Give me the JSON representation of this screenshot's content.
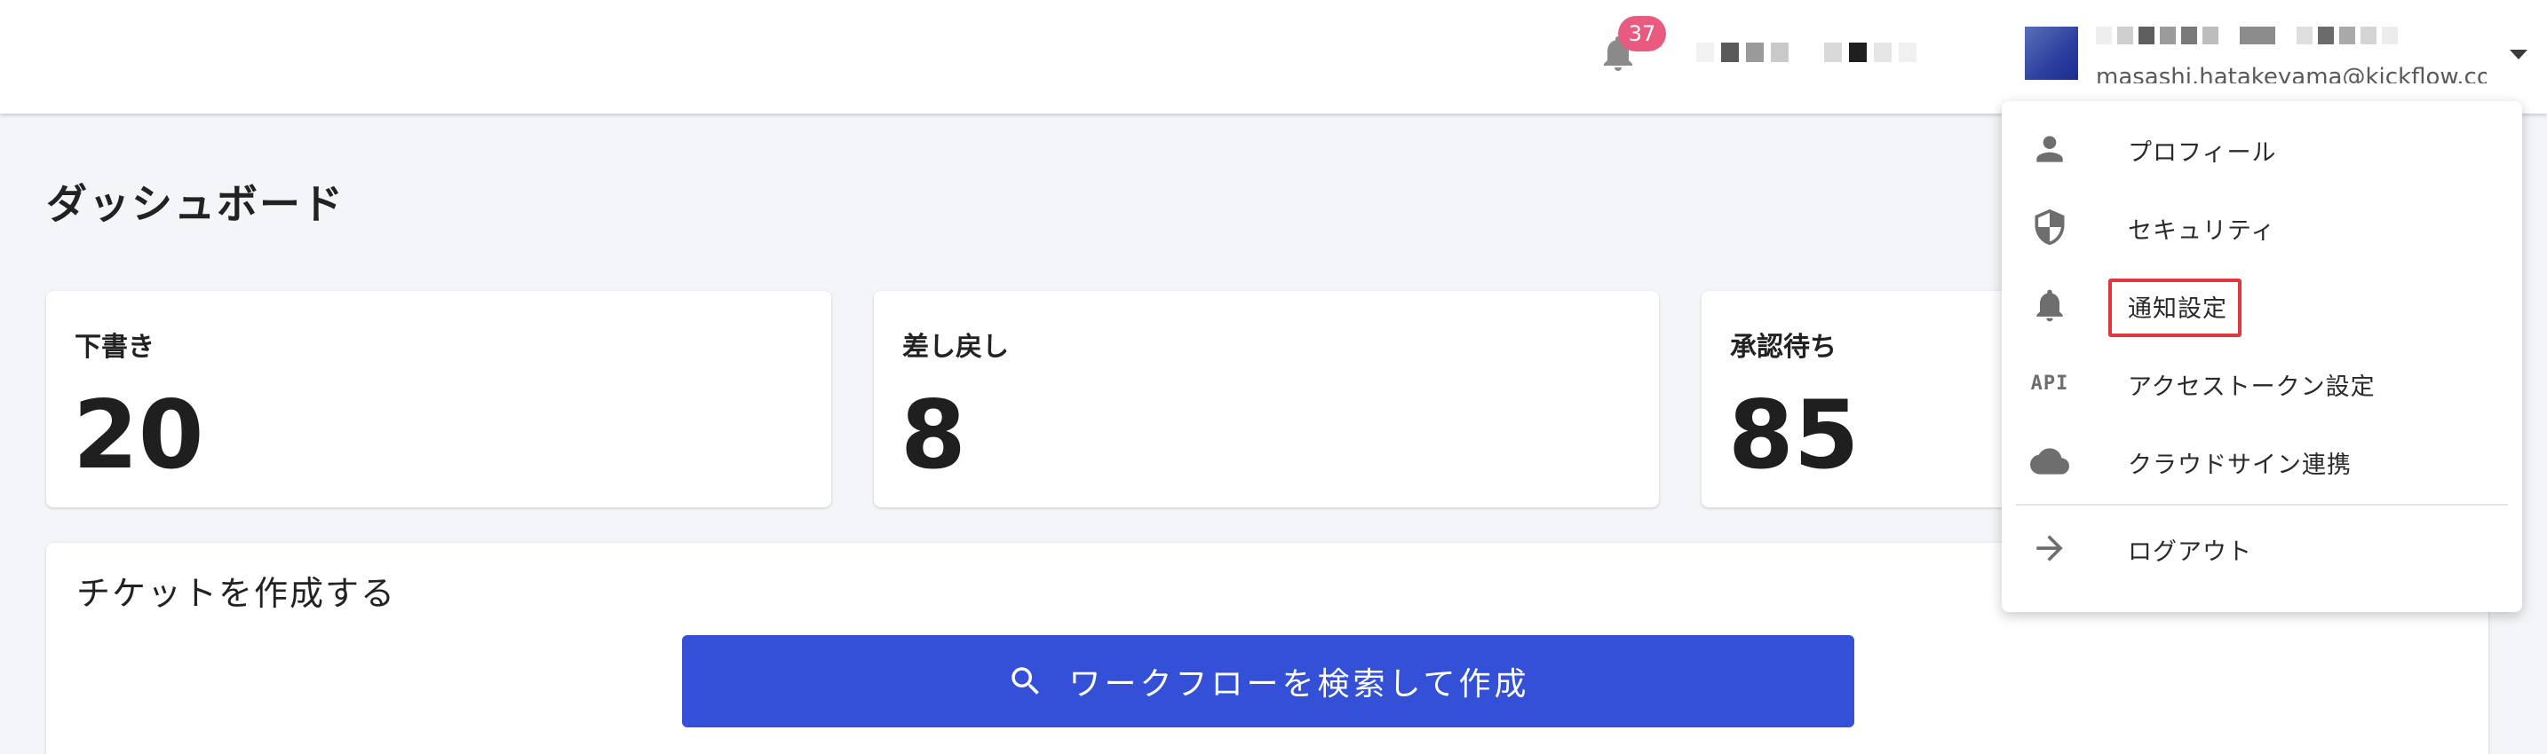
{
  "header": {
    "notification_count": "37",
    "user_email_partial": "masashi.hatakeyama@kickflow.com",
    "accent_badge_color": "#e85a7f",
    "icons": {
      "notifications": "bell-icon",
      "account_menu": "caret-down-icon"
    }
  },
  "page": {
    "title": "ダッシュボード"
  },
  "cards": [
    {
      "label": "下書き",
      "value": "20"
    },
    {
      "label": "差し戻し",
      "value": "8"
    },
    {
      "label": "承認待ち",
      "value": "85"
    }
  ],
  "create_ticket": {
    "title": "チケットを作成する",
    "button_label": "ワークフローを検索して作成",
    "button_color": "#3350d6",
    "button_icon": "search-icon"
  },
  "user_menu": {
    "items": [
      {
        "label": "プロフィール",
        "icon": "person-icon"
      },
      {
        "label": "セキュリティ",
        "icon": "shield-icon"
      },
      {
        "label": "通知設定",
        "icon": "bell-icon",
        "highlighted": true
      },
      {
        "label": "アクセストークン設定",
        "icon": "api-icon",
        "icon_text": "API"
      },
      {
        "label": "クラウドサイン連携",
        "icon": "cloud-icon"
      },
      {
        "label": "ログアウト",
        "icon": "arrow-right-icon"
      }
    ],
    "highlight_color": "#e0363f"
  }
}
